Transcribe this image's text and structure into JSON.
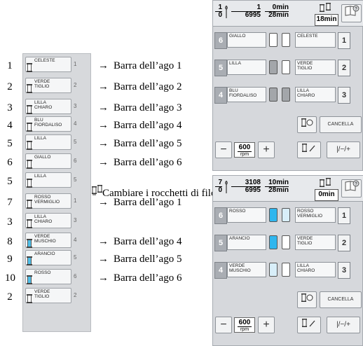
{
  "sequence": {
    "rows": [
      {
        "order": "1",
        "name": "CELESTE",
        "needle": "1",
        "arrow": "→",
        "target": "Barra dell’ago 1",
        "spool": "white"
      },
      {
        "order": "2",
        "name": "VERDE\nTIGLIO",
        "needle": "2",
        "arrow": "→",
        "target": "Barra dell’ago 2",
        "spool": "white"
      },
      {
        "order": "3",
        "name": "LILLA\nCHIARO",
        "needle": "3",
        "arrow": "→",
        "target": "Barra dell’ago 3",
        "spool": "white"
      },
      {
        "order": "4",
        "name": "BLU\nFIORDALISO",
        "needle": "4",
        "arrow": "→",
        "target": "Barra dell’ago 4",
        "spool": "white"
      },
      {
        "order": "5",
        "name": "LILLA",
        "needle": "5",
        "arrow": "→",
        "target": "Barra dell’ago 5",
        "spool": "white"
      },
      {
        "order": "6",
        "name": "GIALLO",
        "needle": "6",
        "arrow": "→",
        "target": "Barra dell’ago 6",
        "spool": "white"
      },
      {
        "order": "5",
        "name": "LILLA",
        "needle": "5",
        "arrow": "",
        "target": "",
        "spool": "white"
      },
      {
        "order": "7",
        "name": "ROSSO\nVERMIGLIO",
        "needle": "1",
        "arrow": "→",
        "target": "Barra dell’ago 1",
        "spool": "white"
      },
      {
        "order": "3",
        "name": "LILLA\nCHIARO",
        "needle": "3",
        "arrow": "",
        "target": "",
        "spool": "white"
      },
      {
        "order": "8",
        "name": "VERDE\nMUSCHIO",
        "needle": "4",
        "arrow": "→",
        "target": "Barra dell’ago 4",
        "spool": "blue"
      },
      {
        "order": "9",
        "name": "ARANCIO",
        "needle": "5",
        "arrow": "→",
        "target": "Barra dell’ago 5",
        "spool": "blue"
      },
      {
        "order": "10",
        "name": "ROSSO",
        "needle": "6",
        "arrow": "→",
        "target": "Barra dell’ago 6",
        "spool": "blue"
      },
      {
        "order": "2",
        "name": "VERDE\nTIGLIO",
        "needle": "2",
        "arrow": "",
        "target": "",
        "spool": "white"
      }
    ],
    "change_message": "Cambiare i rocchetti di filo ora.",
    "change_icon": "spool-change-icon"
  },
  "screen1": {
    "color_counter": {
      "current": "1",
      "total": "0"
    },
    "stitch_counter": {
      "current": "1",
      "total": "6995"
    },
    "time_counter": {
      "current": "0min",
      "total": "28min"
    },
    "remaining_time": "18min",
    "needles_left": [
      {
        "num": "6",
        "name": "GIALLO",
        "spool": "white"
      },
      {
        "num": "5",
        "name": "LILLA",
        "spool": "grey"
      },
      {
        "num": "4",
        "name": "BLU\nFIORDALISO",
        "spool": "grey"
      }
    ],
    "needles_right": [
      {
        "num": "1",
        "name": "CELESTE",
        "spool": "white"
      },
      {
        "num": "2",
        "name": "VERDE\nTIGLIO",
        "spool": "white"
      },
      {
        "num": "3",
        "name": "LILLA\nCHIARO",
        "spool": "grey"
      }
    ],
    "cancel_label": "CANCELLA",
    "speed_value": "600",
    "speed_unit": "rpm",
    "minus_label": "−",
    "plus_label": "+",
    "needle_adjust_label": "|/−/+"
  },
  "screen2": {
    "color_counter": {
      "current": "7",
      "total": "0"
    },
    "stitch_counter": {
      "current": "3108",
      "total": "6995"
    },
    "time_counter": {
      "current": "10min",
      "total": "28min"
    },
    "remaining_time": "0min",
    "needles_left": [
      {
        "num": "6",
        "name": "ROSSO",
        "spool": "blue"
      },
      {
        "num": "5",
        "name": "ARANCIO",
        "spool": "blue"
      },
      {
        "num": "4",
        "name": "VERDE\nMUSCHIO",
        "spool": "lightblue"
      }
    ],
    "needles_right": [
      {
        "num": "1",
        "name": "ROSSO\nVERMIGLIO",
        "spool": "lightblue"
      },
      {
        "num": "2",
        "name": "VERDE\nTIGLIO",
        "spool": "white"
      },
      {
        "num": "3",
        "name": "LILLA\nCHIARO",
        "spool": "white"
      }
    ],
    "cancel_label": "CANCELLA",
    "speed_value": "600",
    "speed_unit": "rpm",
    "minus_label": "−",
    "plus_label": "+",
    "needle_adjust_label": "|/−/+"
  },
  "colors": {
    "spool_blue": "#2fb6ee",
    "spool_light_blue": "#d8eef9",
    "spool_grey": "#a3a6aa",
    "panel_grey": "#d6d8dc"
  }
}
